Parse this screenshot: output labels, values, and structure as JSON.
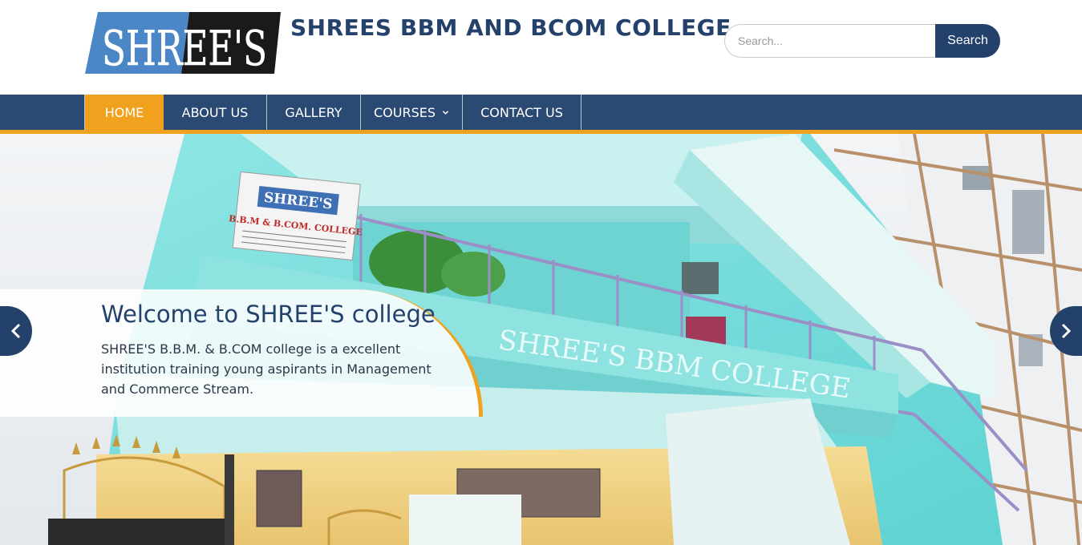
{
  "logo": {
    "text": "SHREE'S"
  },
  "site_title": "SHREES BBM AND BCOM COLLEGE",
  "search": {
    "placeholder": "Search...",
    "button_label": "Search"
  },
  "nav": {
    "items": [
      {
        "label": "HOME",
        "active": true
      },
      {
        "label": "ABOUT US"
      },
      {
        "label": "GALLERY"
      },
      {
        "label": "COURSES",
        "has_dropdown": true
      },
      {
        "label": "CONTACT US"
      }
    ]
  },
  "hero": {
    "caption_title": "Welcome to SHREE'S college",
    "caption_text": "SHREE'S B.B.M. & B.COM college is a excellent institution training young aspirants in Management and Commerce Stream.",
    "photo_sign": {
      "line1": "SHREE'S",
      "line2": "B.B.M & B.COM. COLLEGE",
      "wall_text": "SHREE'S BBM COLLEGE"
    },
    "prev_icon": "chevron-left-icon",
    "next_icon": "chevron-right-icon"
  },
  "colors": {
    "brand": "#24416b",
    "nav_bg": "#2a4a73",
    "accent": "#f0a21f"
  }
}
